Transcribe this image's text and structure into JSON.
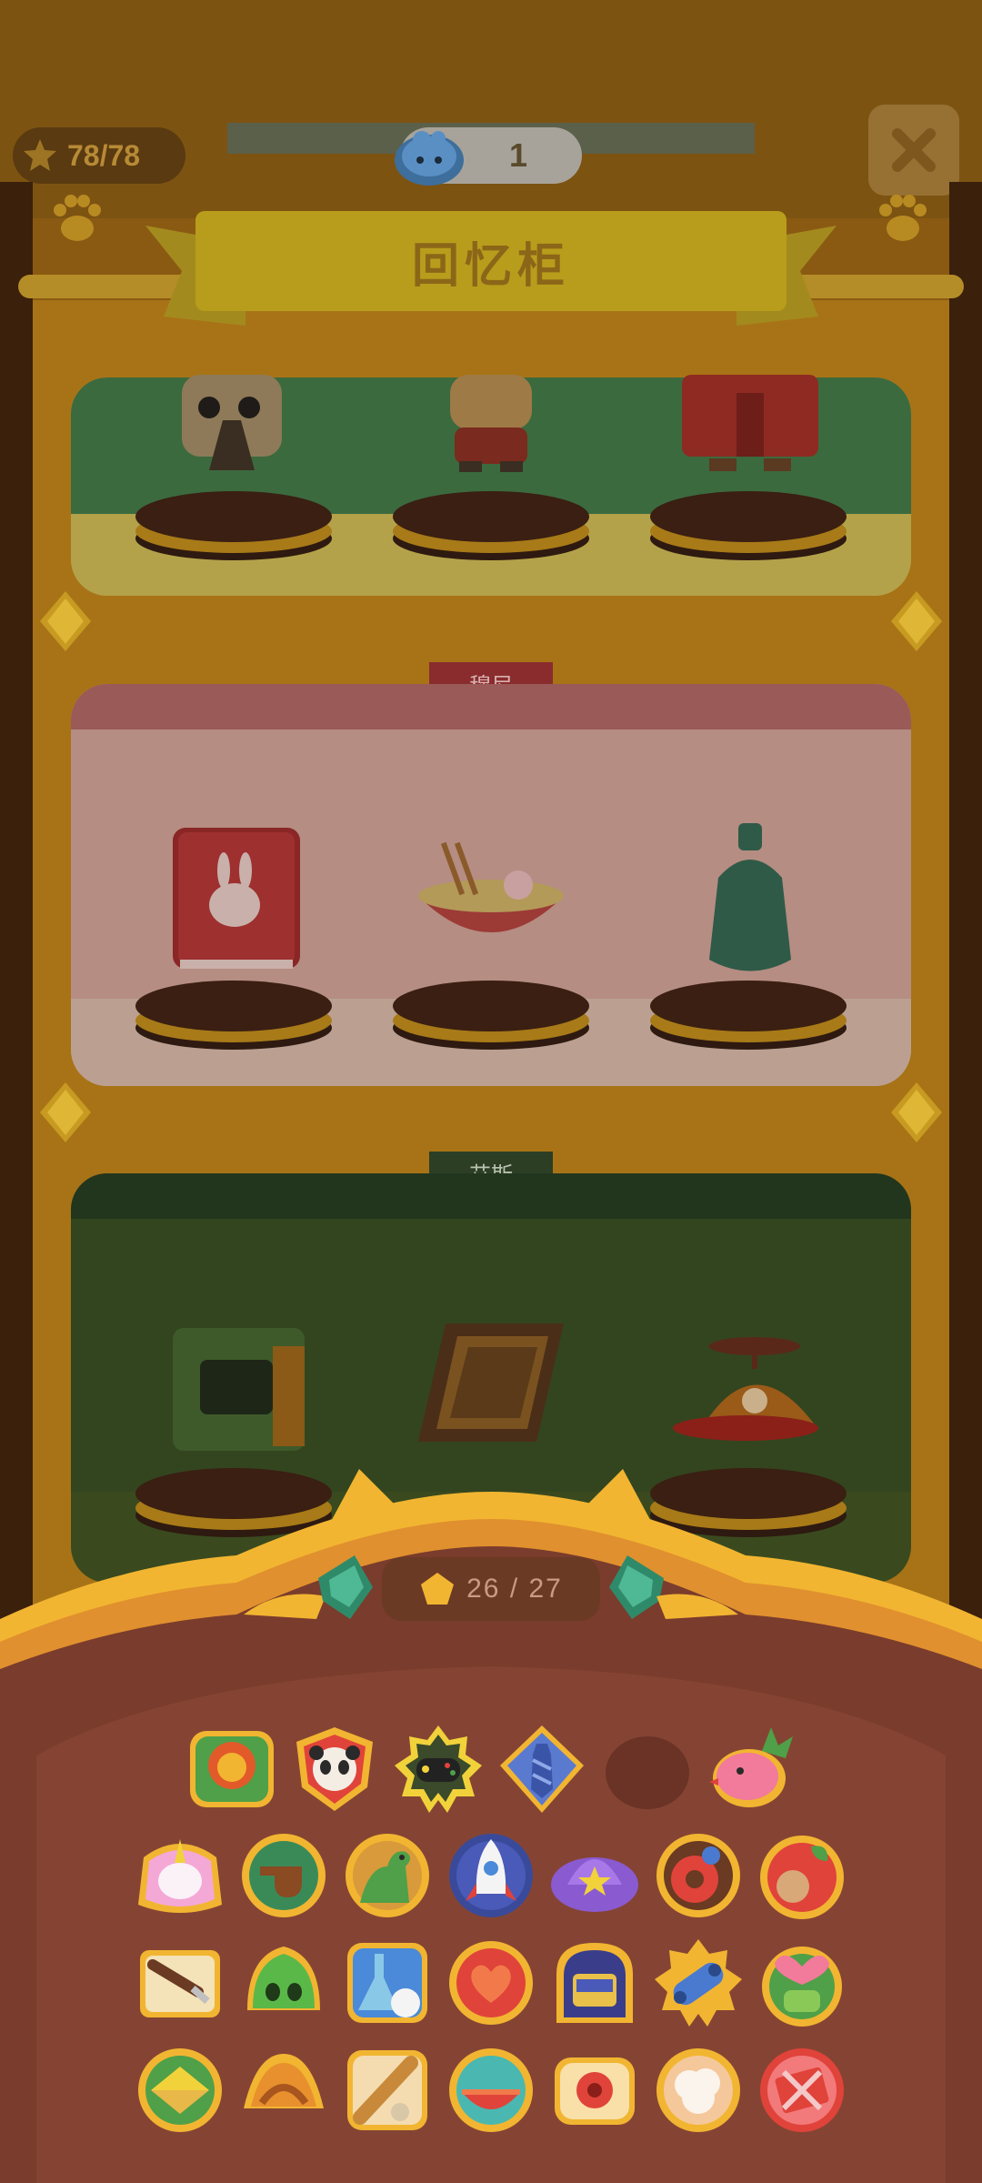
{
  "header": {
    "currency": "78/78",
    "token_count": "1",
    "banner_title": "回忆柜"
  },
  "shelves": [
    {
      "label": "",
      "items": [
        "collectible-doll-icon",
        "collectible-boy-icon",
        "collectible-red-figure-icon"
      ]
    },
    {
      "label": "穆尼",
      "items": [
        "rabbit-book-icon",
        "noodle-bowl-icon",
        "moon-bottle-icon"
      ]
    },
    {
      "label": "艾斯",
      "items": [
        "arcade-machine-icon",
        "photo-frame-icon",
        "propeller-cap-icon"
      ]
    }
  ],
  "tray": {
    "progress": "26 / 27"
  },
  "badges": [
    "lion-badge-icon",
    "panda-badge-icon",
    "gamepad-badge-icon",
    "necktie-badge-icon",
    "empty-badge-slot",
    "pineapple-bird-badge-icon",
    "unicorn-badge-icon",
    "pipe-badge-icon",
    "dinosaur-badge-icon",
    "rocket-badge-icon",
    "planet-hat-badge-icon",
    "donut-badge-icon",
    "apple-badge-icon",
    "paintbrush-badge-icon",
    "slime-badge-icon",
    "flask-badge-icon",
    "heart-fan-badge-icon",
    "bus-badge-icon",
    "skateboard-badge-icon",
    "watering-can-badge-icon",
    "sandwich-badge-icon",
    "croissant-badge-icon",
    "baguette-badge-icon",
    "watermelon-badge-icon",
    "toast-badge-icon",
    "sheep-badge-icon",
    "gift-badge-icon"
  ],
  "colors": {
    "wood": "#a87316",
    "tray_brown": "#7a3c2c",
    "accent_gold": "#f2b531"
  }
}
